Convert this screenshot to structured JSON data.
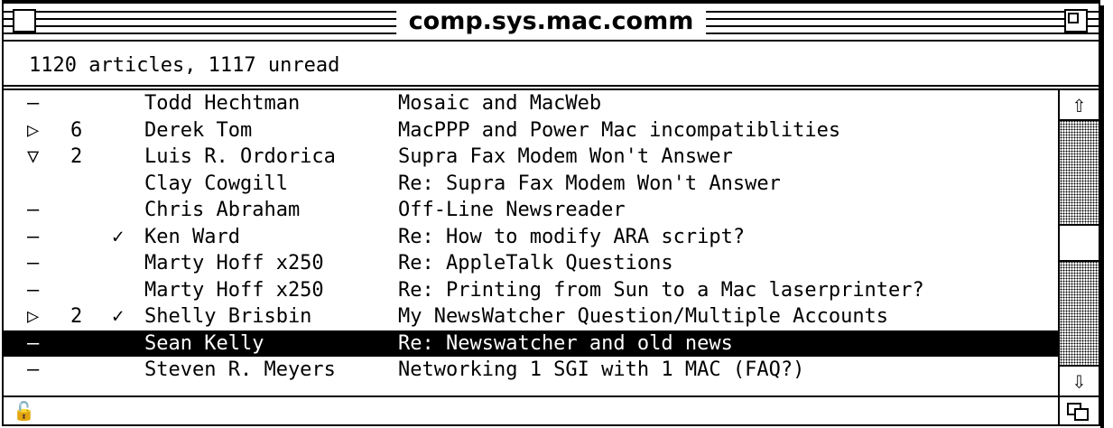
{
  "window": {
    "title": "comp.sys.mac.comm"
  },
  "header": {
    "summary": "1120 articles, 1117 unread"
  },
  "articles": [
    {
      "mark": "–",
      "count": "",
      "check": "",
      "author": "Todd Hechtman",
      "subject": "Mosaic and MacWeb"
    },
    {
      "mark": "▷",
      "count": "6",
      "check": "",
      "author": "Derek Tom",
      "subject": "MacPPP and Power Mac incompatiblities"
    },
    {
      "mark": "▽",
      "count": "2",
      "check": "",
      "author": "Luis R. Ordorica",
      "subject": "Supra Fax Modem Won't Answer"
    },
    {
      "mark": "",
      "count": "",
      "check": "",
      "author": "Clay Cowgill",
      "subject": "Re: Supra Fax Modem Won't Answer"
    },
    {
      "mark": "–",
      "count": "",
      "check": "",
      "author": "Chris Abraham",
      "subject": "Off-Line Newsreader"
    },
    {
      "mark": "–",
      "count": "",
      "check": "✓",
      "author": "Ken Ward",
      "subject": "Re: How to modify ARA script?"
    },
    {
      "mark": "–",
      "count": "",
      "check": "",
      "author": "Marty Hoff x250",
      "subject": "Re: AppleTalk Questions"
    },
    {
      "mark": "–",
      "count": "",
      "check": "",
      "author": "Marty Hoff x250",
      "subject": "Re: Printing from Sun to a Mac laserprinter?"
    },
    {
      "mark": "▷",
      "count": "2",
      "check": "✓",
      "author": "Shelly Brisbin",
      "subject": "My NewsWatcher Question/Multiple Accounts"
    },
    {
      "mark": "–",
      "count": "",
      "check": "",
      "author": "Sean Kelly",
      "subject": "Re: Newswatcher and old news",
      "selected": true
    },
    {
      "mark": "–",
      "count": "",
      "check": "",
      "author": "Steven R. Meyers",
      "subject": "Networking 1 SGI with 1 MAC (FAQ?)"
    }
  ],
  "icons": {
    "scroll_up": "⇧",
    "scroll_down": "⇩",
    "lock": "🔓"
  },
  "scrollbar": {
    "position": 0.5
  }
}
